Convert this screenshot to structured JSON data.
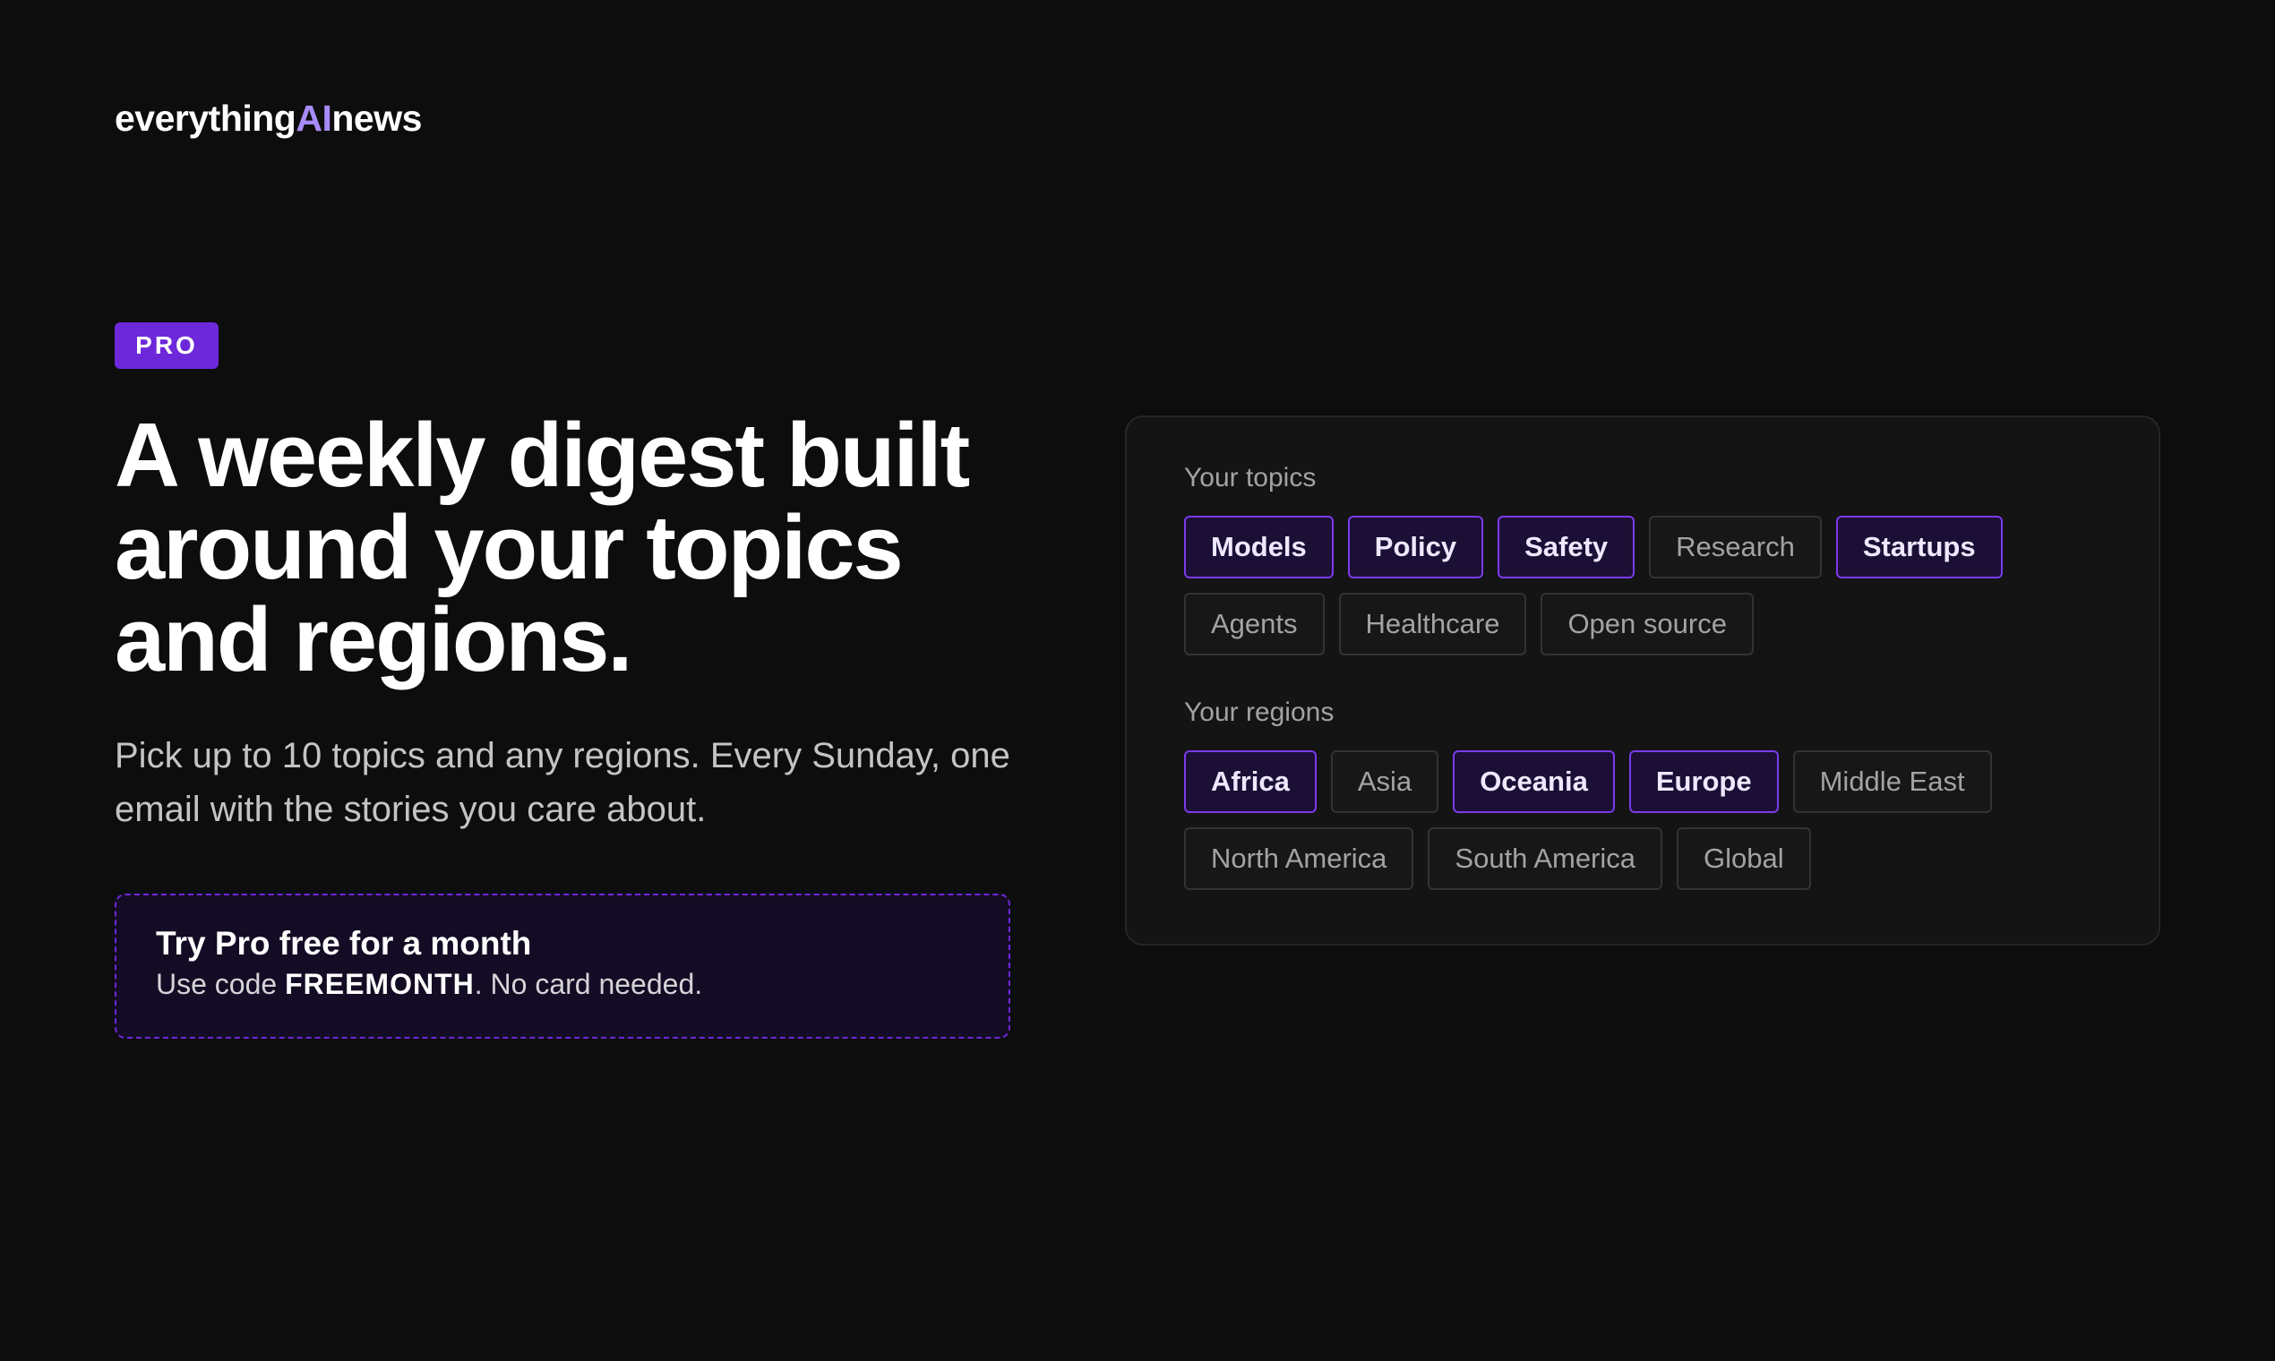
{
  "brand": {
    "prefix": "everything",
    "accent": "AI",
    "suffix": "news",
    "accent_color": "#a78bfa"
  },
  "hero": {
    "badge": "PRO",
    "headline": "A weekly digest built around your topics and regions.",
    "subtitle": "Pick up to 10 topics and any regions. Every Sunday, one email with the stories you care about."
  },
  "promo": {
    "title": "Try Pro free for a month",
    "text_before": "Use code ",
    "code": "FREEMONTH",
    "text_after": ". No card needed."
  },
  "preferences": {
    "topics_label": "Your topics",
    "topics": [
      {
        "label": "Models",
        "selected": true
      },
      {
        "label": "Policy",
        "selected": true
      },
      {
        "label": "Safety",
        "selected": true
      },
      {
        "label": "Research",
        "selected": false
      },
      {
        "label": "Startups",
        "selected": true
      },
      {
        "label": "Agents",
        "selected": false
      },
      {
        "label": "Healthcare",
        "selected": false
      },
      {
        "label": "Open source",
        "selected": false
      }
    ],
    "regions_label": "Your regions",
    "regions": [
      {
        "label": "Africa",
        "selected": true
      },
      {
        "label": "Asia",
        "selected": false
      },
      {
        "label": "Oceania",
        "selected": true
      },
      {
        "label": "Europe",
        "selected": true
      },
      {
        "label": "Middle East",
        "selected": false
      },
      {
        "label": "North America",
        "selected": false
      },
      {
        "label": "South America",
        "selected": false
      },
      {
        "label": "Global",
        "selected": false
      }
    ]
  },
  "colors": {
    "background": "#0d0d0d",
    "brand_purple": "#6d28d9",
    "chip_selected_border": "#7c3aed"
  }
}
